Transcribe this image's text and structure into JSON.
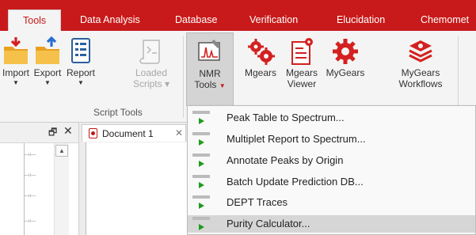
{
  "tabs": [
    {
      "label": "Tools",
      "active": true
    },
    {
      "label": "Data Analysis"
    },
    {
      "label": "Database"
    },
    {
      "label": "Verification"
    },
    {
      "label": "Elucidation"
    },
    {
      "label": "Chemomet"
    }
  ],
  "ribbon": {
    "buttons": [
      {
        "label": "Import",
        "icon": "import-folder-icon"
      },
      {
        "label": "Export",
        "icon": "export-folder-icon"
      },
      {
        "label": "Report",
        "icon": "report-list-icon"
      },
      {
        "label1": "Loaded",
        "label2": "Scripts",
        "icon": "scroll-icon",
        "disabled": true
      },
      {
        "label1": "NMR",
        "label2": "Tools",
        "icon": "nmr-spectrum-icon",
        "pressed": true
      },
      {
        "label": "Mgears",
        "icon": "gears-icon"
      },
      {
        "label1": "Mgears",
        "label2": "Viewer",
        "icon": "gears-document-icon"
      },
      {
        "label": "MyGears",
        "icon": "gear-icon"
      },
      {
        "label1": "MyGears",
        "label2": "Workflows",
        "icon": "stack-layers-icon"
      }
    ],
    "group_label": "Script Tools"
  },
  "panel": {
    "pin": "🗗",
    "close": "✕"
  },
  "document_tab": {
    "name": "Document 1",
    "close": "✕"
  },
  "menu": {
    "items": [
      {
        "label": "Peak Table to Spectrum..."
      },
      {
        "label": "Multiplet Report to Spectrum..."
      },
      {
        "label": "Annotate Peaks by Origin"
      },
      {
        "label": "Batch Update Prediction DB..."
      },
      {
        "label": "DEPT Traces"
      },
      {
        "label": "Purity Calculator...",
        "hover": true
      }
    ]
  },
  "colors": {
    "accent": "#c81a1a",
    "play_green": "#1e9b1e",
    "folder_yellow": "#f2b431"
  }
}
